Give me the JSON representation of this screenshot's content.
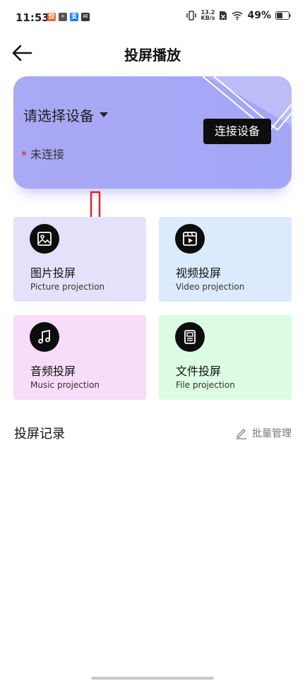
{
  "status_bar": {
    "time": "11:53",
    "notif_icons": [
      {
        "name": "app-notification-icon",
        "glyph": "饺",
        "color": "#ef6a2a"
      },
      {
        "name": "app-notification-icon",
        "glyph": "⚬",
        "color": "#555555"
      },
      {
        "name": "alipay-notification-icon",
        "glyph": "支",
        "color": "#1677ff"
      },
      {
        "name": "mail-notification-icon",
        "glyph": "✉",
        "color": "#333333"
      }
    ],
    "speed_value": "13.2",
    "speed_unit": "KB/s",
    "battery_percent": "49%"
  },
  "header": {
    "title": "投屏播放"
  },
  "device_card": {
    "select_label": "请选择设备",
    "connect_button": "连接设备",
    "status": "未连接",
    "status_color": "#d94f64"
  },
  "features": [
    {
      "title": "图片投屏",
      "subtitle": "Picture projection",
      "icon": "picture-icon",
      "bg": "#e4e2fb"
    },
    {
      "title": "视频投屏",
      "subtitle": "Video projection",
      "icon": "video-icon",
      "bg": "#dbeafd"
    },
    {
      "title": "音频投屏",
      "subtitle": "Music projection",
      "icon": "music-icon",
      "bg": "#f8dcfa"
    },
    {
      "title": "文件投屏",
      "subtitle": "File projection",
      "icon": "file-icon",
      "bg": "#dcfbe3"
    }
  ],
  "records": {
    "title": "投屏记录",
    "batch_label": "批量管理"
  },
  "colors": {
    "card_bg": "#a6a7f5",
    "accent_dark": "#0d0d0d",
    "annotation_red": "#e0242b"
  }
}
